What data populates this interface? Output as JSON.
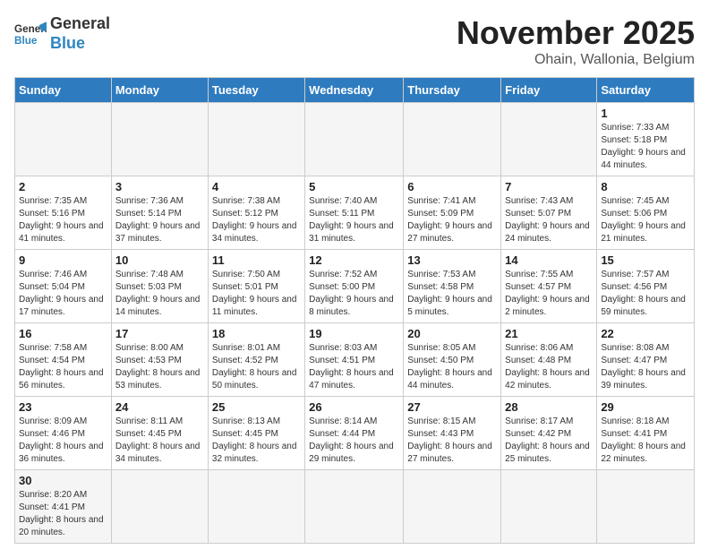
{
  "header": {
    "logo_general": "General",
    "logo_blue": "Blue",
    "month_title": "November 2025",
    "location": "Ohain, Wallonia, Belgium"
  },
  "weekdays": [
    "Sunday",
    "Monday",
    "Tuesday",
    "Wednesday",
    "Thursday",
    "Friday",
    "Saturday"
  ],
  "weeks": [
    [
      {
        "day": "",
        "info": ""
      },
      {
        "day": "",
        "info": ""
      },
      {
        "day": "",
        "info": ""
      },
      {
        "day": "",
        "info": ""
      },
      {
        "day": "",
        "info": ""
      },
      {
        "day": "",
        "info": ""
      },
      {
        "day": "1",
        "info": "Sunrise: 7:33 AM\nSunset: 5:18 PM\nDaylight: 9 hours\nand 44 minutes."
      }
    ],
    [
      {
        "day": "2",
        "info": "Sunrise: 7:35 AM\nSunset: 5:16 PM\nDaylight: 9 hours\nand 41 minutes."
      },
      {
        "day": "3",
        "info": "Sunrise: 7:36 AM\nSunset: 5:14 PM\nDaylight: 9 hours\nand 37 minutes."
      },
      {
        "day": "4",
        "info": "Sunrise: 7:38 AM\nSunset: 5:12 PM\nDaylight: 9 hours\nand 34 minutes."
      },
      {
        "day": "5",
        "info": "Sunrise: 7:40 AM\nSunset: 5:11 PM\nDaylight: 9 hours\nand 31 minutes."
      },
      {
        "day": "6",
        "info": "Sunrise: 7:41 AM\nSunset: 5:09 PM\nDaylight: 9 hours\nand 27 minutes."
      },
      {
        "day": "7",
        "info": "Sunrise: 7:43 AM\nSunset: 5:07 PM\nDaylight: 9 hours\nand 24 minutes."
      },
      {
        "day": "8",
        "info": "Sunrise: 7:45 AM\nSunset: 5:06 PM\nDaylight: 9 hours\nand 21 minutes."
      }
    ],
    [
      {
        "day": "9",
        "info": "Sunrise: 7:46 AM\nSunset: 5:04 PM\nDaylight: 9 hours\nand 17 minutes."
      },
      {
        "day": "10",
        "info": "Sunrise: 7:48 AM\nSunset: 5:03 PM\nDaylight: 9 hours\nand 14 minutes."
      },
      {
        "day": "11",
        "info": "Sunrise: 7:50 AM\nSunset: 5:01 PM\nDaylight: 9 hours\nand 11 minutes."
      },
      {
        "day": "12",
        "info": "Sunrise: 7:52 AM\nSunset: 5:00 PM\nDaylight: 9 hours\nand 8 minutes."
      },
      {
        "day": "13",
        "info": "Sunrise: 7:53 AM\nSunset: 4:58 PM\nDaylight: 9 hours\nand 5 minutes."
      },
      {
        "day": "14",
        "info": "Sunrise: 7:55 AM\nSunset: 4:57 PM\nDaylight: 9 hours\nand 2 minutes."
      },
      {
        "day": "15",
        "info": "Sunrise: 7:57 AM\nSunset: 4:56 PM\nDaylight: 8 hours\nand 59 minutes."
      }
    ],
    [
      {
        "day": "16",
        "info": "Sunrise: 7:58 AM\nSunset: 4:54 PM\nDaylight: 8 hours\nand 56 minutes."
      },
      {
        "day": "17",
        "info": "Sunrise: 8:00 AM\nSunset: 4:53 PM\nDaylight: 8 hours\nand 53 minutes."
      },
      {
        "day": "18",
        "info": "Sunrise: 8:01 AM\nSunset: 4:52 PM\nDaylight: 8 hours\nand 50 minutes."
      },
      {
        "day": "19",
        "info": "Sunrise: 8:03 AM\nSunset: 4:51 PM\nDaylight: 8 hours\nand 47 minutes."
      },
      {
        "day": "20",
        "info": "Sunrise: 8:05 AM\nSunset: 4:50 PM\nDaylight: 8 hours\nand 44 minutes."
      },
      {
        "day": "21",
        "info": "Sunrise: 8:06 AM\nSunset: 4:48 PM\nDaylight: 8 hours\nand 42 minutes."
      },
      {
        "day": "22",
        "info": "Sunrise: 8:08 AM\nSunset: 4:47 PM\nDaylight: 8 hours\nand 39 minutes."
      }
    ],
    [
      {
        "day": "23",
        "info": "Sunrise: 8:09 AM\nSunset: 4:46 PM\nDaylight: 8 hours\nand 36 minutes."
      },
      {
        "day": "24",
        "info": "Sunrise: 8:11 AM\nSunset: 4:45 PM\nDaylight: 8 hours\nand 34 minutes."
      },
      {
        "day": "25",
        "info": "Sunrise: 8:13 AM\nSunset: 4:45 PM\nDaylight: 8 hours\nand 32 minutes."
      },
      {
        "day": "26",
        "info": "Sunrise: 8:14 AM\nSunset: 4:44 PM\nDaylight: 8 hours\nand 29 minutes."
      },
      {
        "day": "27",
        "info": "Sunrise: 8:15 AM\nSunset: 4:43 PM\nDaylight: 8 hours\nand 27 minutes."
      },
      {
        "day": "28",
        "info": "Sunrise: 8:17 AM\nSunset: 4:42 PM\nDaylight: 8 hours\nand 25 minutes."
      },
      {
        "day": "29",
        "info": "Sunrise: 8:18 AM\nSunset: 4:41 PM\nDaylight: 8 hours\nand 22 minutes."
      }
    ],
    [
      {
        "day": "30",
        "info": "Sunrise: 8:20 AM\nSunset: 4:41 PM\nDaylight: 8 hours\nand 20 minutes."
      },
      {
        "day": "",
        "info": ""
      },
      {
        "day": "",
        "info": ""
      },
      {
        "day": "",
        "info": ""
      },
      {
        "day": "",
        "info": ""
      },
      {
        "day": "",
        "info": ""
      },
      {
        "day": "",
        "info": ""
      }
    ]
  ]
}
